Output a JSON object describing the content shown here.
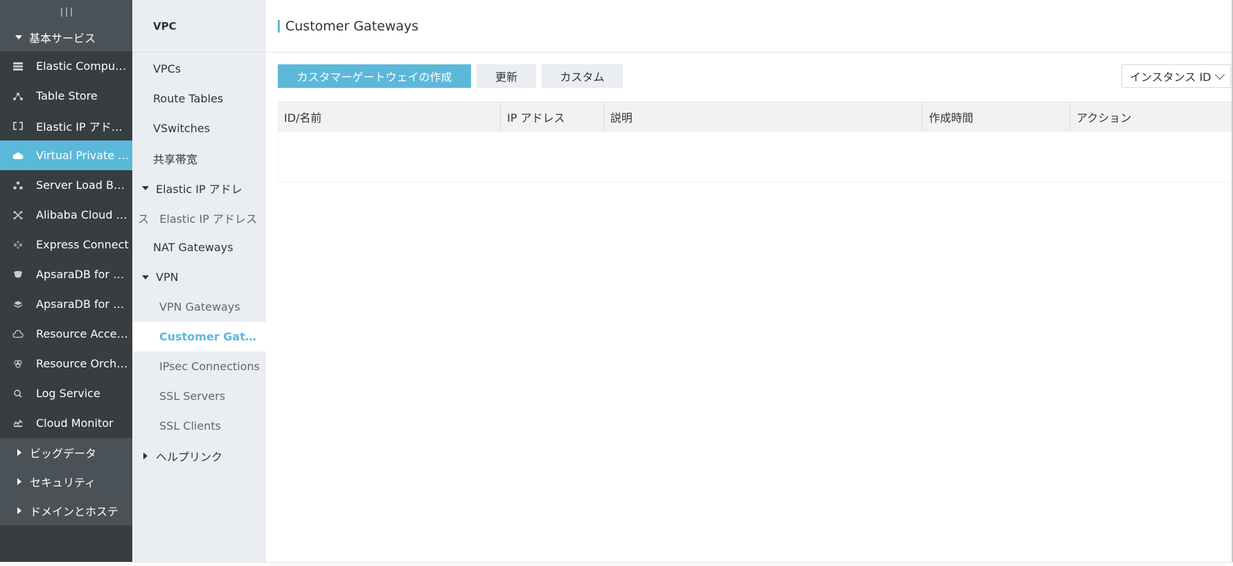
{
  "global_sidebar": {
    "group_basic": "基本サービス",
    "items": [
      {
        "label": "Elastic Comput…",
        "icon": "server-stack-icon"
      },
      {
        "label": "Table Store",
        "icon": "table-store-icon"
      },
      {
        "label": "Elastic IP アド…",
        "icon": "ip-bracket-icon"
      },
      {
        "label": "Virtual Private C…",
        "icon": "cloud-icon",
        "active": true
      },
      {
        "label": "Server Load Bal…",
        "icon": "load-balancer-icon"
      },
      {
        "label": "Alibaba Cloud C…",
        "icon": "network-cross-icon"
      },
      {
        "label": "Express Connect",
        "icon": "express-connect-icon"
      },
      {
        "label": "ApsaraDB for R…",
        "icon": "database-icon"
      },
      {
        "label": "ApsaraDB for R…",
        "icon": "layers-icon"
      },
      {
        "label": "Resource Acces…",
        "icon": "cloud-outline-icon"
      },
      {
        "label": "Resource Orche…",
        "icon": "orchestration-icon"
      },
      {
        "label": "Log Service",
        "icon": "log-search-icon"
      },
      {
        "label": "Cloud Monitor",
        "icon": "monitor-icon"
      }
    ],
    "groups_collapsed": [
      "ビッグデータ",
      "セキュリティ",
      "ドメインとホステ"
    ]
  },
  "product_sidebar": {
    "title": "VPC",
    "vpcs": "VPCs",
    "route_tables": "Route Tables",
    "vswitches": "VSwitches",
    "shared_bandwidth": "共享帯宽",
    "eip_parent": "Elastic IP アドレ",
    "eip_child": "ス   Elastic IP アドレス",
    "nat_gateways": "NAT Gateways",
    "vpn_parent": "VPN",
    "vpn_gateways": "VPN Gateways",
    "customer_gateways": "Customer Gate…",
    "ipsec": "IPsec Connections",
    "ssl_servers": "SSL Servers",
    "ssl_clients": "SSL Clients",
    "help_links": "ヘルプリンク"
  },
  "main": {
    "title": "Customer Gateways",
    "create_button": "カスタマーゲートウェイの作成",
    "refresh_button": "更新",
    "custom_button": "カスタム",
    "instance_select": "インスタンス ID",
    "columns": [
      {
        "label": "ID/名前"
      },
      {
        "label": "IP アドレス"
      },
      {
        "label": "説明"
      },
      {
        "label": "作成時間"
      },
      {
        "label": "アクション"
      }
    ]
  },
  "colors": {
    "accent": "#5cb8d9",
    "sidebar_dark": "#373d41",
    "sidebar_group": "#4a5157",
    "product_sidebar": "#eaedf1"
  }
}
